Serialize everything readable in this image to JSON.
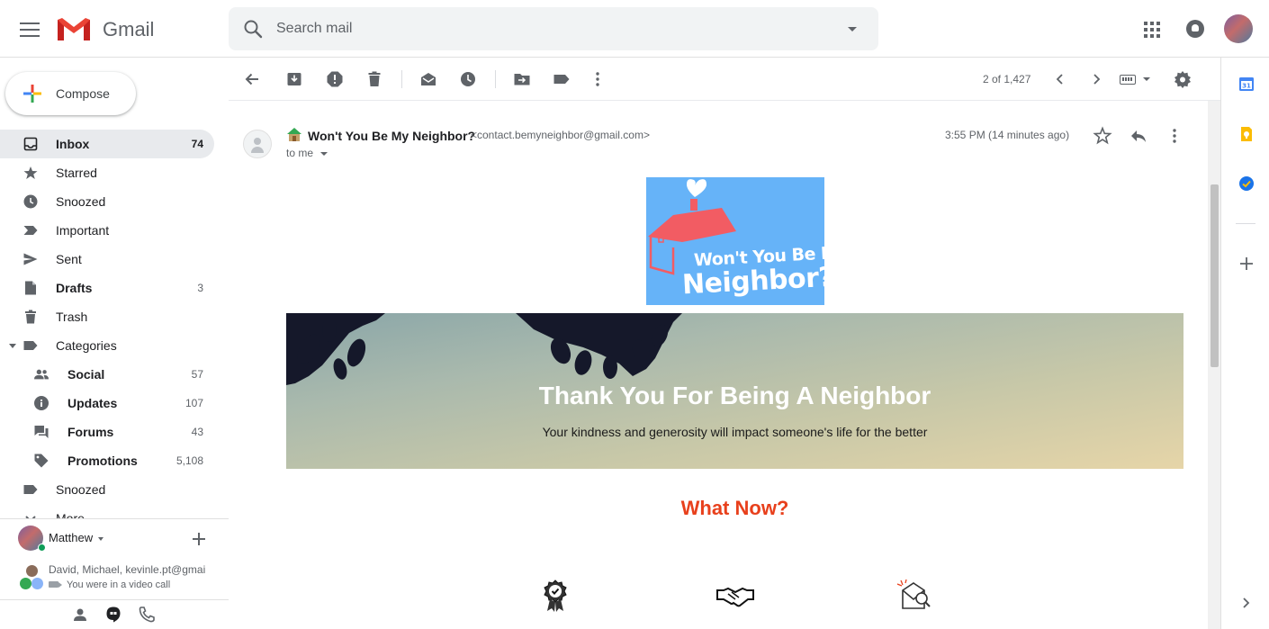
{
  "app": {
    "name": "Gmail"
  },
  "search": {
    "placeholder": "Search mail"
  },
  "compose": {
    "label": "Compose"
  },
  "nav": [
    {
      "label": "Inbox",
      "count": "74",
      "bold": true,
      "active": true,
      "icon": "inbox-icon"
    },
    {
      "label": "Starred",
      "count": "",
      "icon": "star-icon"
    },
    {
      "label": "Snoozed",
      "count": "",
      "icon": "clock-icon"
    },
    {
      "label": "Important",
      "count": "",
      "icon": "important-icon"
    },
    {
      "label": "Sent",
      "count": "",
      "icon": "send-icon"
    },
    {
      "label": "Drafts",
      "count": "3",
      "bold": true,
      "icon": "draft-icon"
    },
    {
      "label": "Trash",
      "count": "",
      "icon": "trash-icon"
    },
    {
      "label": "Categories",
      "count": "",
      "icon": "label-icon"
    },
    {
      "label": "Social",
      "count": "57",
      "bold": true,
      "sub": true,
      "icon": "people-icon"
    },
    {
      "label": "Updates",
      "count": "107",
      "bold": true,
      "sub": true,
      "icon": "info-icon"
    },
    {
      "label": "Forums",
      "count": "43",
      "bold": true,
      "sub": true,
      "icon": "forum-icon"
    },
    {
      "label": "Promotions",
      "count": "5,108",
      "bold": true,
      "sub": true,
      "icon": "tag-icon"
    },
    {
      "label": "Snoozed",
      "count": "",
      "icon": "label-icon"
    },
    {
      "label": "More",
      "count": "",
      "icon": "chevron-down-icon"
    }
  ],
  "hangouts": {
    "user_name": "Matthew",
    "conversation_names": "David, Michael, kevinle.pt@gmail.com",
    "conversation_status": "You were in a video call"
  },
  "toolbar": {
    "pager": "2 of 1,427"
  },
  "message": {
    "sender_name": "Won't You Be My Neighbor?",
    "sender_email": "<contact.bemyneighbor@gmail.com>",
    "to": "to me",
    "time": "3:55 PM (14 minutes ago)"
  },
  "email_body": {
    "logo_line1": "Won't You Be My",
    "logo_line2": "Neighbor?",
    "hero_title": "Thank You For Being A Neighbor",
    "hero_subtitle": "Your kindness and generosity will impact someone's life for the better",
    "section_heading": "What Now?"
  },
  "colors": {
    "accent_red": "#e8401c",
    "logo_blue": "#66b3f8",
    "gmail_red": "#ea4335"
  }
}
